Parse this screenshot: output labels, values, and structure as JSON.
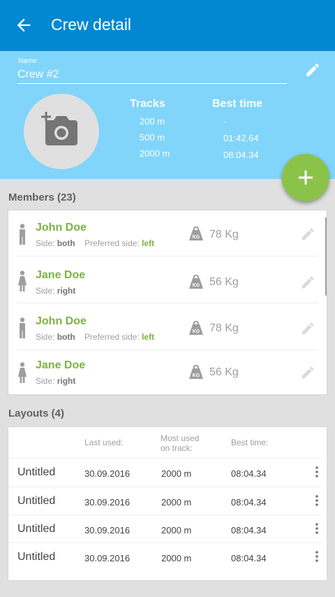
{
  "appbar": {
    "title": "Crew detail"
  },
  "crew": {
    "name_label": "Name",
    "name_value": "Crew #2",
    "tracks_header": "Tracks",
    "best_time_header": "Best time",
    "tracks": [
      "200 m",
      "500 m",
      "2000 m"
    ],
    "best_times": [
      "-",
      "01:42.64",
      "08:04.34"
    ]
  },
  "members": {
    "title": "Members (23)",
    "side_prefix": "Side:",
    "preferred_prefix": "Preferred side:",
    "items": [
      {
        "name": "John Doe",
        "gender": "male",
        "side": "both",
        "preferred": "left",
        "weight": "78 Kg"
      },
      {
        "name": "Jane Doe",
        "gender": "female",
        "side": "right",
        "preferred": "",
        "weight": "56 Kg"
      },
      {
        "name": "John Doe",
        "gender": "male",
        "side": "both",
        "preferred": "left",
        "weight": "78 Kg"
      },
      {
        "name": "Jane Doe",
        "gender": "female",
        "side": "right",
        "preferred": "",
        "weight": "56 Kg"
      }
    ]
  },
  "layouts": {
    "title": "Layouts (4)",
    "headers": {
      "last_used": "Last used:",
      "most_used_1": "Most used",
      "most_used_2": "on track:",
      "best_time": "Best time:"
    },
    "rows": [
      {
        "name": "Untitled",
        "last_used": "30.09.2016",
        "most_used": "2000 m",
        "best_time": "08:04.34"
      },
      {
        "name": "Untitled",
        "last_used": "30.09.2016",
        "most_used": "2000 m",
        "best_time": "08:04.34"
      },
      {
        "name": "Untitled",
        "last_used": "30.09.2016",
        "most_used": "2000 m",
        "best_time": "08:04.34"
      },
      {
        "name": "Untitled",
        "last_used": "30.09.2016",
        "most_used": "2000 m",
        "best_time": "08:04.34"
      }
    ]
  },
  "icons": {
    "back": "arrow-left-icon",
    "edit": "pencil-icon",
    "photo": "add-photo-icon",
    "add": "plus-icon",
    "weight": "kg-weight-icon",
    "more": "more-vertical-icon"
  },
  "colors": {
    "primary": "#0288d1",
    "header_bg": "#81d4fa",
    "accent_green": "#8bc34a",
    "name_green": "#7cb342"
  }
}
